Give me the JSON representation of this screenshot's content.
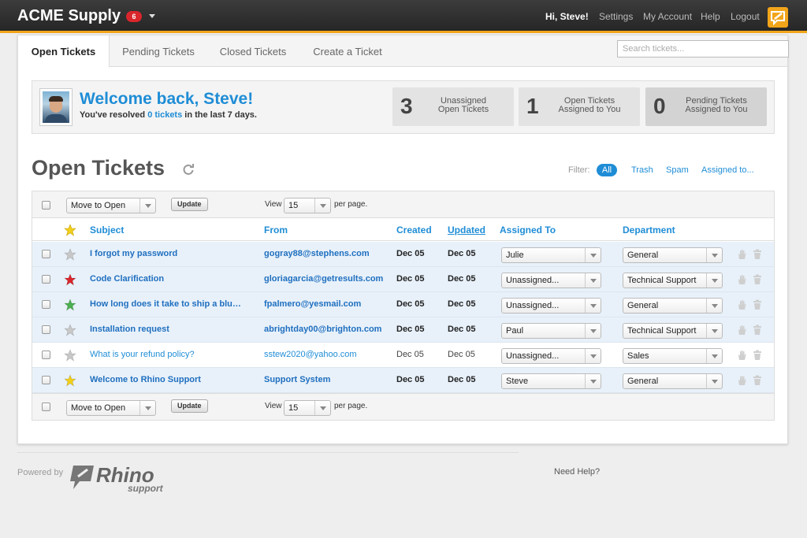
{
  "header": {
    "brand": "ACME Supply",
    "brand_badge": "6",
    "greeting": "Hi, Steve!",
    "nav": [
      "Settings",
      "My Account",
      "Help",
      "Logout"
    ]
  },
  "tabs": [
    "Open Tickets",
    "Pending Tickets",
    "Closed Tickets",
    "Create a Ticket"
  ],
  "search": {
    "placeholder": "Search tickets..."
  },
  "welcome": {
    "title": "Welcome back, Steve!",
    "sub_before": "You've resolved",
    "sub_link": "0 tickets",
    "sub_after": "in the last 7 days."
  },
  "stats": [
    {
      "num": "3",
      "line1": "Unassigned",
      "line2": "Open Tickets"
    },
    {
      "num": "1",
      "line1": "Open Tickets",
      "line2": "Assigned to You"
    },
    {
      "num": "0",
      "line1": "Pending Tickets",
      "line2": "Assigned to You"
    }
  ],
  "page_title": "Open Tickets",
  "filter": {
    "label": "Filter:",
    "active": "All",
    "links": [
      "Trash",
      "Spam",
      "Assigned to..."
    ]
  },
  "toolbar": {
    "move_option": "Move to Open",
    "update_label": "Update",
    "view_label": "View",
    "per_page_value": "15",
    "per_page_label": "per page."
  },
  "columns": {
    "subject": "Subject",
    "from": "From",
    "created": "Created",
    "updated": "Updated",
    "assigned": "Assigned To",
    "department": "Department"
  },
  "rows": [
    {
      "subject": "I forgot my password",
      "from": "gogray88@stephens.com",
      "created": "Dec 05",
      "updated": "Dec 05",
      "assigned": "Julie",
      "department": "General",
      "star": "gray",
      "unread": true
    },
    {
      "subject": "Code Clarification",
      "from": "gloriagarcia@getresults.com",
      "created": "Dec 05",
      "updated": "Dec 05",
      "assigned": "Unassigned...",
      "department": "Technical Support",
      "star": "red",
      "unread": true
    },
    {
      "subject": "How long does it take to ship a blue widget?",
      "from": "fpalmero@yesmail.com",
      "created": "Dec 05",
      "updated": "Dec 05",
      "assigned": "Unassigned...",
      "department": "General",
      "star": "green",
      "unread": true
    },
    {
      "subject": "Installation request",
      "from": "abrightday00@brighton.com",
      "created": "Dec 05",
      "updated": "Dec 05",
      "assigned": "Paul",
      "department": "Technical Support",
      "star": "gray",
      "unread": true
    },
    {
      "subject": "What is your refund policy?",
      "from": "sstew2020@yahoo.com",
      "created": "Dec 05",
      "updated": "Dec 05",
      "assigned": "Unassigned...",
      "department": "Sales",
      "star": "gray",
      "unread": false
    },
    {
      "subject": "Welcome to Rhino Support",
      "from": "Support System",
      "created": "Dec 05",
      "updated": "Dec 05",
      "assigned": "Steve",
      "department": "General",
      "star": "yellow",
      "unread": true
    }
  ],
  "star_colors": {
    "gray": "#c8c8c8",
    "red": "#d9262c",
    "green": "#4caf50",
    "yellow": "#f2cf1b"
  },
  "footer": {
    "powered_by": "Powered by",
    "logo_word": "Rhino",
    "logo_sub": "support",
    "need_help": "Need Help?"
  },
  "colors": {
    "accent": "#1f8dd6",
    "brand_orange": "#f2a51b",
    "topbar": "#2e2e2e"
  }
}
